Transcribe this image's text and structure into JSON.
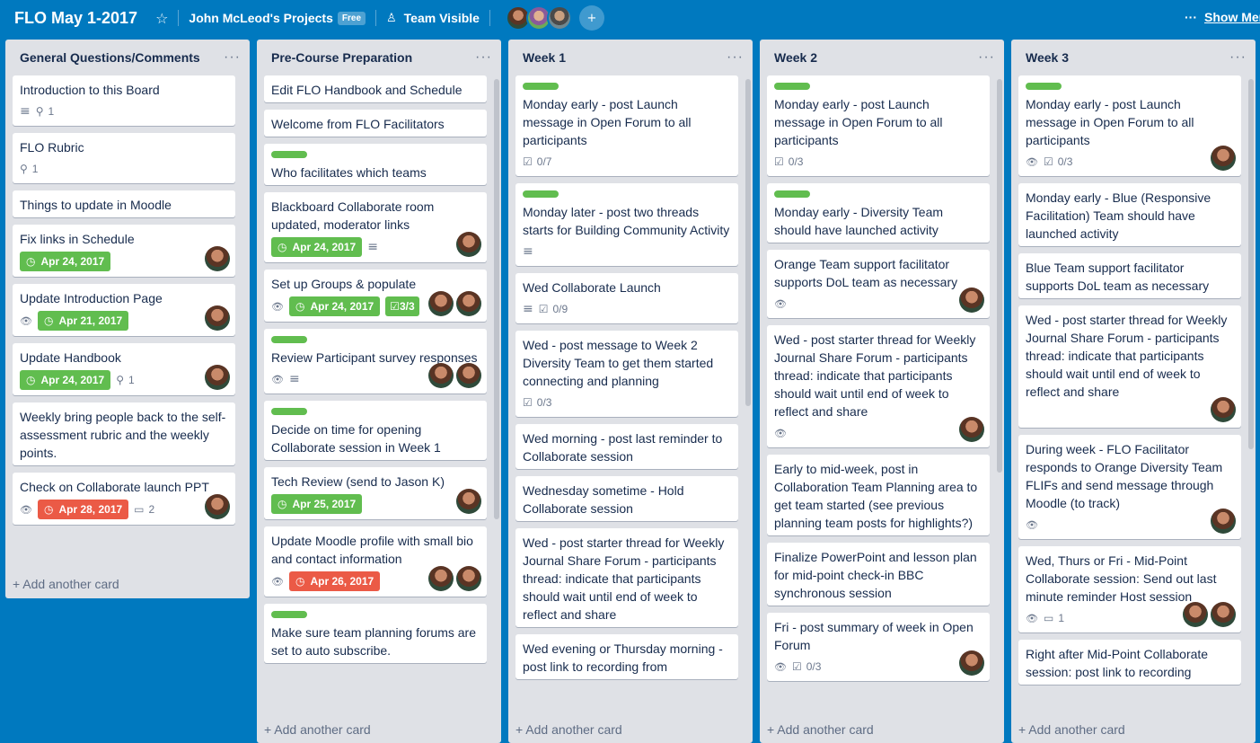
{
  "header": {
    "board_title": "FLO May 1-2017",
    "team_name": "John McLeod's Projects",
    "team_badge": "Free",
    "visibility": "Team Visible",
    "show_menu": "Show Menu"
  },
  "icons": {
    "star": "star-icon",
    "visibility": "people-icon",
    "invite": "add-member-icon",
    "description": "description-icon",
    "attachment": "paperclip-icon",
    "checklist": "checklist-icon",
    "watch": "eye-icon",
    "comment": "comment-icon",
    "clock": "clock-icon",
    "more": "ellipsis-icon"
  },
  "colors": {
    "board_bg": "#0079bf",
    "green_label": "#61bd4f",
    "overdue": "#eb5a46",
    "list_bg": "#dfe1e6"
  },
  "add_card_label": "+ Add another card",
  "lists": [
    {
      "title": "General Questions/Comments",
      "cards": [
        {
          "title": "Introduction to this Board",
          "attachments": "1"
        },
        {
          "title": "FLO Rubric",
          "attachments": "1"
        },
        {
          "title": "Things to update in Moodle"
        },
        {
          "title": "Fix links in Schedule",
          "due": "Apr 24, 2017"
        },
        {
          "title": "Update Introduction Page",
          "due": "Apr 21, 2017"
        },
        {
          "title": "Update Handbook",
          "due": "Apr 24, 2017",
          "attachments": "1"
        },
        {
          "title": "Weekly bring people back to the self-assessment rubric and the weekly points."
        },
        {
          "title": "Check on Collaborate launch PPT",
          "due": "Apr 28, 2017",
          "comments": "2"
        }
      ]
    },
    {
      "title": "Pre-Course Preparation",
      "cards": [
        {
          "title": "Edit FLO Handbook and Schedule"
        },
        {
          "title": "Welcome from FLO Facilitators"
        },
        {
          "title": "Who facilitates which teams"
        },
        {
          "title": "Blackboard Collaborate room updated, moderator links",
          "due": "Apr 24, 2017"
        },
        {
          "title": "Set up Groups & populate",
          "due": "Apr 24, 2017",
          "checklist": "3/3"
        },
        {
          "title": "Review Participant survey responses"
        },
        {
          "title": "Decide on time for opening Collaborate session in Week 1"
        },
        {
          "title": "Tech Review (send to Jason K)",
          "due": "Apr 25, 2017"
        },
        {
          "title": "Update Moodle profile with small bio and contact information",
          "due": "Apr 26, 2017"
        },
        {
          "title": "Make sure team planning forums are set to auto subscribe."
        }
      ]
    },
    {
      "title": "Week 1",
      "cards": [
        {
          "title": "Monday early - post Launch message in Open Forum to all participants",
          "checklist": "0/7"
        },
        {
          "title": "Monday later - post two threads starts for Building Community Activity"
        },
        {
          "title": "Wed Collaborate Launch",
          "checklist": "0/9"
        },
        {
          "title": "Wed - post message to Week 2 Diversity Team to get them started connecting and planning",
          "checklist": "0/3"
        },
        {
          "title": "Wed morning - post last reminder to Collaborate session"
        },
        {
          "title": "Wednesday sometime - Hold Collaborate session"
        },
        {
          "title": "Wed - post starter thread for Weekly Journal Share Forum - participants thread: indicate that participants should wait until end of week to reflect and share"
        },
        {
          "title": "Wed evening or Thursday morning - post link to recording from"
        }
      ]
    },
    {
      "title": "Week 2",
      "cards": [
        {
          "title": "Monday early - post Launch message in Open Forum to all participants",
          "checklist": "0/3"
        },
        {
          "title": "Monday early - Diversity Team should have launched activity"
        },
        {
          "title": "Orange Team support facilitator supports DoL team as necessary"
        },
        {
          "title": "Wed - post starter thread for Weekly Journal Share Forum - participants thread: indicate that participants should wait until end of week to reflect and share"
        },
        {
          "title": "Early to mid-week, post in Collaboration Team Planning area to get team started (see previous planning team posts for highlights?)"
        },
        {
          "title": "Finalize PowerPoint and lesson plan for mid-point check-in BBC synchronous session"
        },
        {
          "title": "Fri - post summary of week in Open Forum",
          "checklist": "0/3"
        }
      ]
    },
    {
      "title": "Week 3",
      "cards": [
        {
          "title": "Monday early - post Launch message in Open Forum to all participants",
          "checklist": "0/3"
        },
        {
          "title": "Monday early - Blue (Responsive Facilitation) Team should have launched activity"
        },
        {
          "title": "Blue Team support facilitator supports DoL team as necessary"
        },
        {
          "title": "Wed - post starter thread for Weekly Journal Share Forum - participants thread: indicate that participants should wait until end of week to reflect and share"
        },
        {
          "title": "During week - FLO Facilitator responds to Orange Diversity Team FLIFs and send message through Moodle (to track)"
        },
        {
          "title": "Wed, Thurs or Fri - Mid-Point Collaborate session: Send out last minute reminder Host session",
          "comments": "1"
        },
        {
          "title": "Right after Mid-Point Collaborate session: post link to recording"
        }
      ]
    }
  ]
}
